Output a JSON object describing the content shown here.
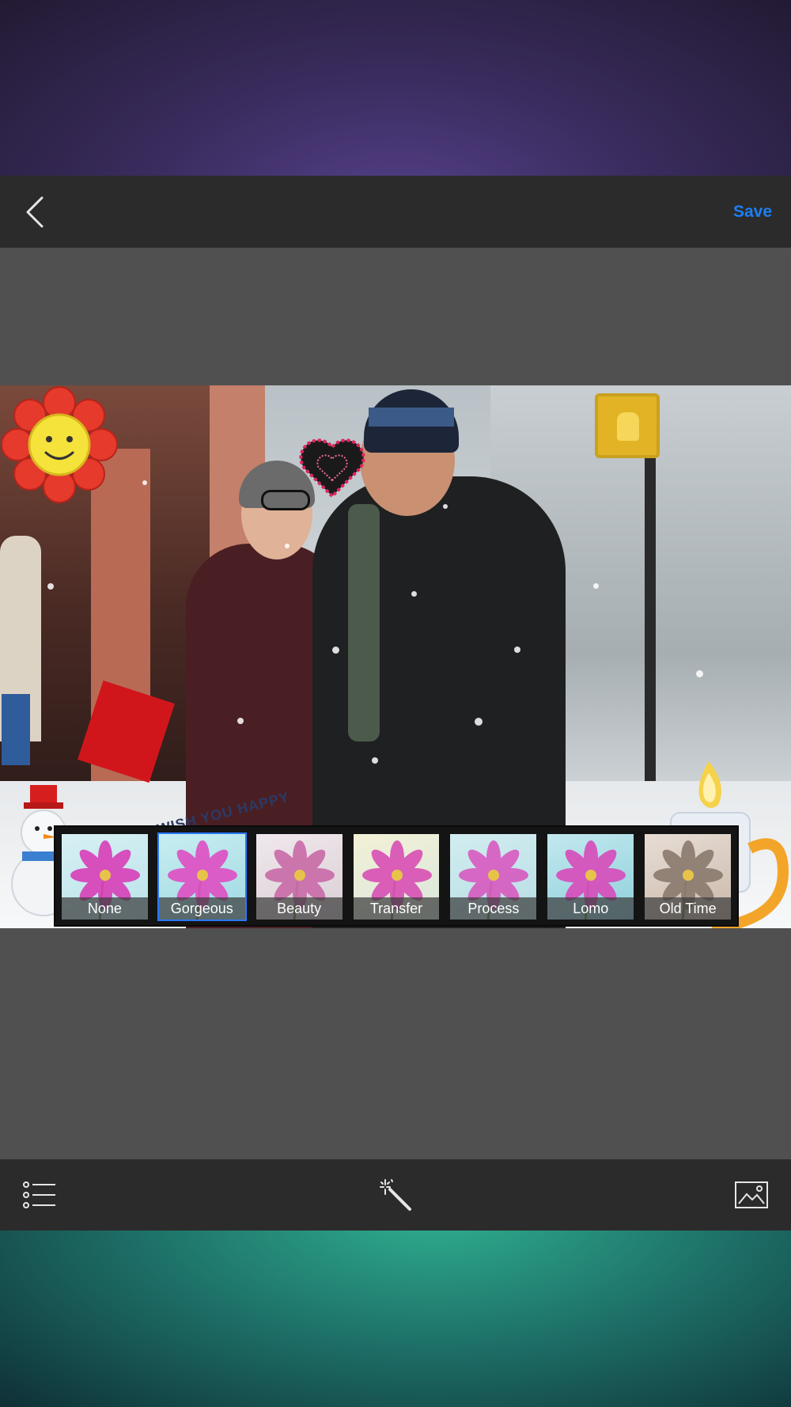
{
  "topbar": {
    "back_icon": "chevron-left-icon",
    "save_label": "Save"
  },
  "photo": {
    "sticker_text": "WE WISH YOU HAPPY"
  },
  "filters": {
    "selected": "Gorgeous",
    "items": [
      {
        "label": "None"
      },
      {
        "label": "Gorgeous"
      },
      {
        "label": "Beauty"
      },
      {
        "label": "Transfer"
      },
      {
        "label": "Process"
      },
      {
        "label": "Lomo"
      },
      {
        "label": "Old Time"
      }
    ]
  },
  "bottombar": {
    "left_icon": "list-icon",
    "center_icon": "magic-wand-icon",
    "right_icon": "image-icon"
  },
  "colors": {
    "accent": "#1c7ff2",
    "bar_bg": "#2b2b2b",
    "canvas_bg": "#505050",
    "selected_border": "#2a78ff"
  }
}
